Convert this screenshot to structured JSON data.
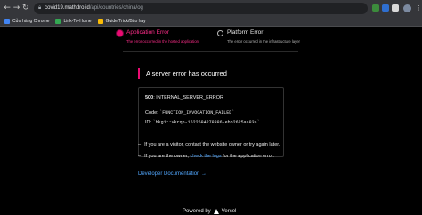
{
  "browser": {
    "url_host": "covid19.mathdro.id",
    "url_path": "/api/countries/china/og",
    "bookmarks": [
      {
        "label": "Cửa hàng Chrome",
        "color": "#4285f4"
      },
      {
        "label": "Link-To-Home",
        "color": "#34a853"
      },
      {
        "label": "Guide/Trick/Bảo hay",
        "color": "#fbbc05"
      }
    ],
    "extension_colors": [
      "#3c8b3c",
      "#2f6fd0",
      "#d9d9d9",
      "#aaaaaa"
    ]
  },
  "tabs": {
    "application": {
      "title": "Application Error",
      "desc": "The error occurred in the hosted application"
    },
    "platform": {
      "title": "Platform Error",
      "desc": "The error occurred in the infrastructure layer"
    }
  },
  "error": {
    "heading": "A server error has occurred",
    "code_number": "500",
    "code_name": ": INTERNAL_SERVER_ERROR",
    "code_label": "Code:",
    "code_value": "`FUNCTION_INVOCATION_FAILED`",
    "id_label": "ID:",
    "id_value": "`hkg1::vkrqh-1622684278386-ebb2625aa83a`"
  },
  "help": {
    "visitor_text": "If you are a visitor, contact the website owner or try again later.",
    "owner_prefix": "If you are the owner,",
    "owner_link": "check the logs",
    "owner_suffix": "for the application error."
  },
  "docs_link": "Developer Documentation →",
  "footer": {
    "label": "Powered by",
    "brand": "Vercel"
  },
  "colors": {
    "accent": "#ea0b72",
    "link": "#52a8ff"
  }
}
